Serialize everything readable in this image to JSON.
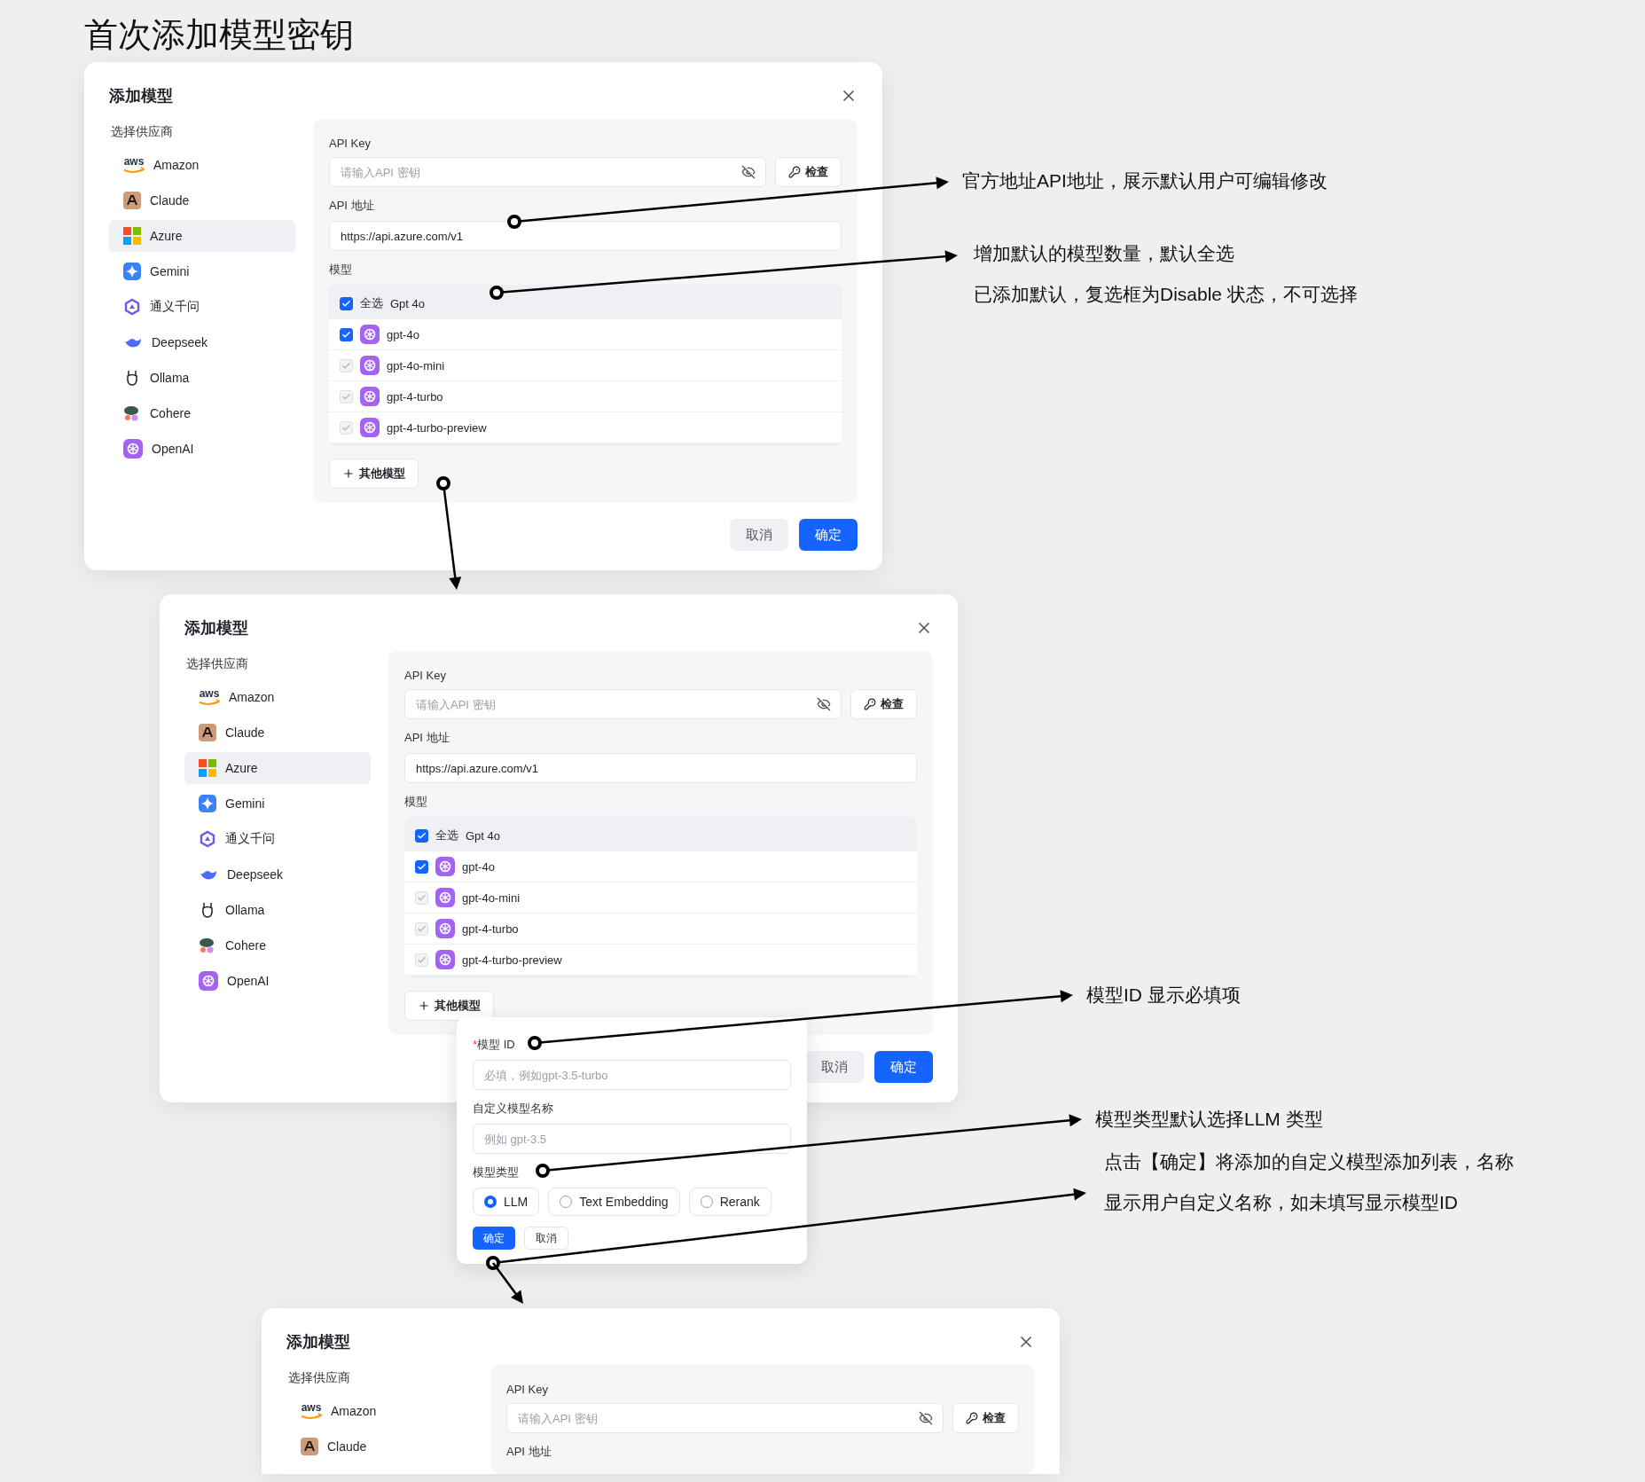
{
  "title": "首次添加模型密钥",
  "dialogs": [
    {
      "title": "添加模型",
      "provider_label": "选择供应商",
      "providers": [
        {
          "name": "Amazon",
          "badge": "aws",
          "selected": false
        },
        {
          "name": "Claude",
          "selected": false
        },
        {
          "name": "Azure",
          "selected": true
        },
        {
          "name": "Gemini",
          "selected": false
        },
        {
          "name": "通义千问",
          "selected": false
        },
        {
          "name": "Deepseek",
          "selected": false
        },
        {
          "name": "Ollama",
          "selected": false
        },
        {
          "name": "Cohere",
          "selected": false
        },
        {
          "name": "OpenAI",
          "selected": false
        }
      ],
      "api_key": {
        "label": "API Key",
        "placeholder": "请输入API 密钥",
        "check": "检查"
      },
      "api_url": {
        "label": "API 地址",
        "value": "https://api.azure.com/v1"
      },
      "models": {
        "label": "模型",
        "select_all": {
          "label": "全选",
          "checked": true
        },
        "group": "Gpt 4o",
        "items": [
          {
            "name": "gpt-4o",
            "checked": true,
            "disabled": false
          },
          {
            "name": "gpt-4o-mini",
            "checked": true,
            "disabled": true
          },
          {
            "name": "gpt-4-turbo",
            "checked": true,
            "disabled": true
          },
          {
            "name": "gpt-4-turbo-preview",
            "checked": true,
            "disabled": true
          }
        ]
      },
      "add_other": "其他模型",
      "buttons": {
        "cancel": "取消",
        "confirm": "确定"
      }
    },
    {
      "title": "添加模型",
      "provider_label": "选择供应商",
      "providers": [
        {
          "name": "Amazon",
          "badge": "aws",
          "selected": false
        },
        {
          "name": "Claude",
          "selected": false
        },
        {
          "name": "Azure",
          "selected": true
        },
        {
          "name": "Gemini",
          "selected": false
        },
        {
          "name": "通义千问",
          "selected": false
        },
        {
          "name": "Deepseek",
          "selected": false
        },
        {
          "name": "Ollama",
          "selected": false
        },
        {
          "name": "Cohere",
          "selected": false
        },
        {
          "name": "OpenAI",
          "selected": false
        }
      ],
      "api_key": {
        "label": "API Key",
        "placeholder": "请输入API 密钥",
        "check": "检查"
      },
      "api_url": {
        "label": "API 地址",
        "value": "https://api.azure.com/v1"
      },
      "models": {
        "label": "模型",
        "select_all": {
          "label": "全选",
          "checked": true
        },
        "group": "Gpt 4o",
        "items": [
          {
            "name": "gpt-4o",
            "checked": true,
            "disabled": false
          },
          {
            "name": "gpt-4o-mini",
            "checked": true,
            "disabled": true
          },
          {
            "name": "gpt-4-turbo",
            "checked": true,
            "disabled": true
          },
          {
            "name": "gpt-4-turbo-preview",
            "checked": true,
            "disabled": true
          }
        ]
      },
      "add_other": "其他模型",
      "buttons": {
        "cancel": "取消",
        "confirm": "确定"
      }
    },
    {
      "title": "添加模型",
      "provider_label": "选择供应商",
      "providers": [
        {
          "name": "Amazon",
          "badge": "aws",
          "selected": false
        },
        {
          "name": "Claude",
          "selected": false
        }
      ],
      "api_key": {
        "label": "API Key",
        "placeholder": "请输入API 密钥",
        "check": "检查"
      },
      "api_url": {
        "label": "API 地址"
      }
    }
  ],
  "popover": {
    "model_id": {
      "label": "模型 ID",
      "required_mark": "*",
      "placeholder": "必填，例如gpt-3.5-turbo"
    },
    "custom_name": {
      "label": "自定义模型名称",
      "placeholder": "例如 gpt-3.5"
    },
    "model_type": {
      "label": "模型类型",
      "options": [
        {
          "label": "LLM",
          "selected": true
        },
        {
          "label": "Text Embedding",
          "selected": false
        },
        {
          "label": "Rerank",
          "selected": false
        }
      ]
    },
    "buttons": {
      "confirm": "确定",
      "cancel": "取消"
    }
  },
  "annotations": [
    {
      "lines": [
        "官方地址API地址，展示默认用户可编辑修改"
      ]
    },
    {
      "lines": [
        "增加默认的模型数量，默认全选",
        "已添加默认，复选框为Disable 状态，不可选择"
      ]
    },
    {
      "lines": [
        "模型ID 显示必填项"
      ]
    },
    {
      "lines": [
        "模型类型默认选择LLM 类型"
      ]
    },
    {
      "lines": [
        "点击【确定】将添加的自定义模型添加列表，名称",
        "显示用户自定义名称，如未填写显示模型ID"
      ]
    }
  ]
}
